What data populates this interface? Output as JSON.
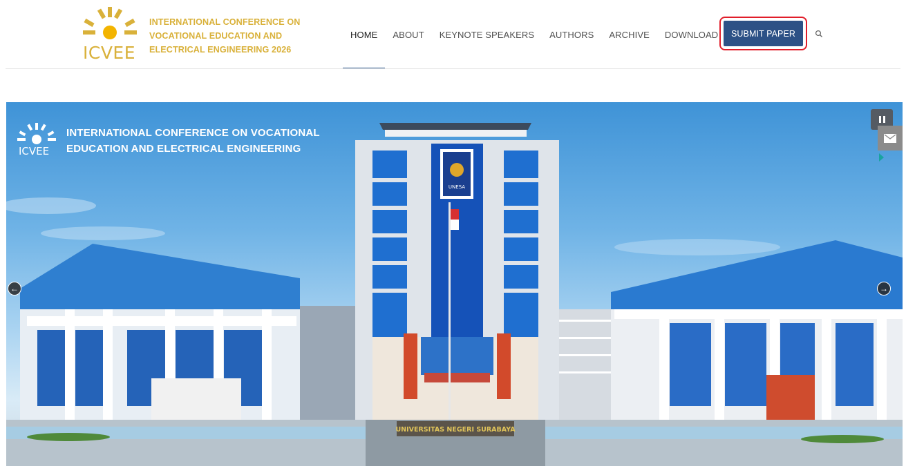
{
  "brand": {
    "acronym": "ICVEE",
    "title_lines": [
      "INTERNATIONAL CONFERENCE ON",
      "VOCATIONAL EDUCATION AND",
      "ELECTRICAL ENGINEERING 2026"
    ],
    "color": "#d9b13a"
  },
  "nav": {
    "items": [
      "HOME",
      "ABOUT",
      "KEYNOTE SPEAKERS",
      "AUTHORS",
      "ARCHIVE",
      "DOWNLOAD"
    ],
    "active": "HOME",
    "submit_label": "SUBMIT PAPER",
    "submit_color": "#2d5186",
    "highlight_color": "#e11d2a"
  },
  "hero": {
    "acronym": "ICVEE",
    "title_lines": [
      "INTERNATIONAL CONFERENCE ON VOCATIONAL",
      "EDUCATION AND ELECTRICAL ENGINEERING"
    ],
    "building_sign": "UNIVERSITAS NEGERI SURABAYA",
    "tower_sign": "UNESA"
  },
  "icons": {
    "search": "search-icon",
    "prev": "arrow-left-circle-icon",
    "next": "arrow-right-circle-icon",
    "pause": "pause-icon",
    "mail": "mail-icon"
  }
}
